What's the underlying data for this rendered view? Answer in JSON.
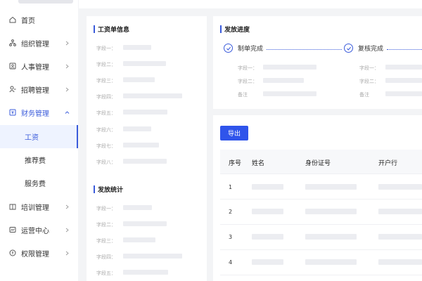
{
  "sidebar": {
    "items": [
      {
        "label": "首页",
        "icon": "home-icon"
      },
      {
        "label": "组织管理",
        "icon": "org-icon"
      },
      {
        "label": "人事管理",
        "icon": "personnel-icon"
      },
      {
        "label": "招聘管理",
        "icon": "recruit-icon"
      },
      {
        "label": "财务管理",
        "icon": "finance-icon"
      },
      {
        "label": "培训管理",
        "icon": "training-icon"
      },
      {
        "label": "运营中心",
        "icon": "operations-icon"
      },
      {
        "label": "权限管理",
        "icon": "permission-icon"
      }
    ],
    "sub_items": [
      {
        "label": "工资"
      },
      {
        "label": "推荐费"
      },
      {
        "label": "服务费"
      }
    ],
    "accent": "#3a5bdb"
  },
  "salary_info": {
    "title": "工资单信息",
    "fields": [
      "字段一：",
      "字段二：",
      "字段三：",
      "字段四：",
      "字段五：",
      "字段六：",
      "字段七：",
      "字段八："
    ]
  },
  "payout_stats": {
    "title": "发放统计",
    "fields": [
      "字段一：",
      "字段二：",
      "字段三：",
      "字段四：",
      "字段五："
    ]
  },
  "progress": {
    "title": "发放进度",
    "steps": [
      {
        "label": "制单完成",
        "fields": [
          "字段一：",
          "字段二：",
          "备注"
        ]
      },
      {
        "label": "复核完成",
        "fields": [
          "字段一：",
          "字段二：",
          "备注"
        ]
      }
    ]
  },
  "table": {
    "export_label": "导出",
    "columns": [
      "序号",
      "姓名",
      "身份证号",
      "开户行"
    ],
    "rows": [
      "1",
      "2",
      "3",
      "4"
    ]
  }
}
